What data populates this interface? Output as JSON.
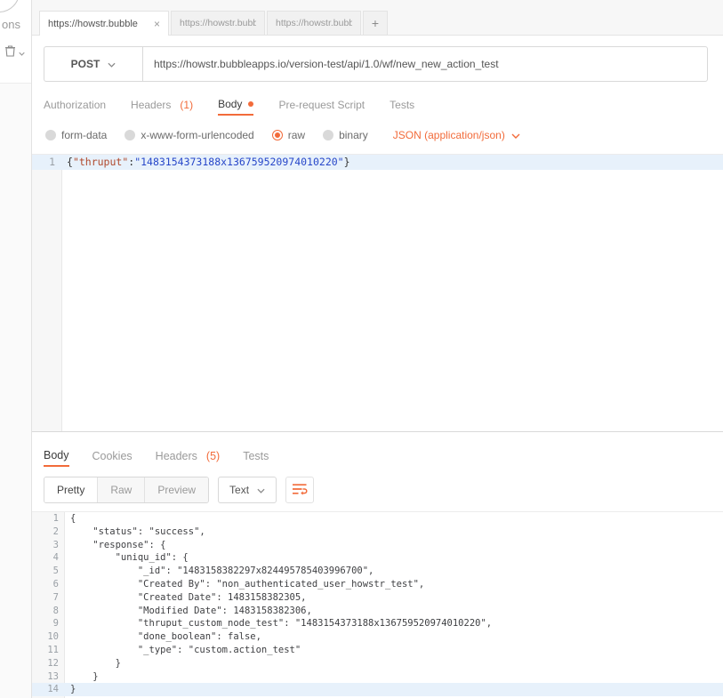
{
  "colors": {
    "accent": "#f26b3a",
    "line_highlight": "#e7f1fb"
  },
  "sidebar": {
    "partial_label": "ons"
  },
  "tabbar": {
    "close_glyph": "×",
    "new_tab_label": "+",
    "tabs": [
      {
        "label": "https://howstr.bubble",
        "active": true
      },
      {
        "label": "https://howstr.bubbleapps.i",
        "active": false
      },
      {
        "label": "https://howstr.bubbleapps.i",
        "active": false
      }
    ]
  },
  "request": {
    "method": "POST",
    "url": "https://howstr.bubbleapps.io/version-test/api/1.0/wf/new_new_action_test",
    "tabs": [
      {
        "label": "Authorization",
        "active": false
      },
      {
        "label": "Headers (1)",
        "active": false
      },
      {
        "label": "Body",
        "active": true,
        "dot": true
      },
      {
        "label": "Pre-request Script",
        "active": false
      },
      {
        "label": "Tests",
        "active": false
      }
    ],
    "body_modes": [
      {
        "label": "form-data",
        "selected": false
      },
      {
        "label": "x-www-form-urlencoded",
        "selected": false
      },
      {
        "label": "raw",
        "selected": true
      },
      {
        "label": "binary",
        "selected": false
      }
    ],
    "content_type": "JSON (application/json)",
    "editor": {
      "line_number": "1",
      "highlighted": true,
      "tokens": [
        {
          "text": "{",
          "type": "punct"
        },
        {
          "text": "\"thruput\"",
          "type": "key"
        },
        {
          "text": ":",
          "type": "punct"
        },
        {
          "text": "\"1483154373188x136759520974010220\"",
          "type": "string"
        },
        {
          "text": "}",
          "type": "punct"
        }
      ]
    }
  },
  "response": {
    "tabs": [
      {
        "label": "Body",
        "active": true
      },
      {
        "label": "Cookies",
        "active": false
      },
      {
        "label": "Headers (5)",
        "active": false
      },
      {
        "label": "Tests",
        "active": false
      }
    ],
    "view_modes": [
      {
        "label": "Pretty",
        "active": true
      },
      {
        "label": "Raw",
        "active": false
      },
      {
        "label": "Preview",
        "active": false
      }
    ],
    "format_select": "Text",
    "highlighted_line": 14,
    "body_lines": [
      "{",
      "    \"status\": \"success\",",
      "    \"response\": {",
      "        \"uniqu_id\": {",
      "            \"_id\": \"1483158382297x824495785403996700\",",
      "            \"Created By\": \"non_authenticated_user_howstr_test\",",
      "            \"Created Date\": 1483158382305,",
      "            \"Modified Date\": 1483158382306,",
      "            \"thruput_custom_node_test\": \"1483154373188x136759520974010220\",",
      "            \"done_boolean\": false,",
      "            \"_type\": \"custom.action_test\"",
      "        }",
      "    }",
      "}"
    ]
  }
}
